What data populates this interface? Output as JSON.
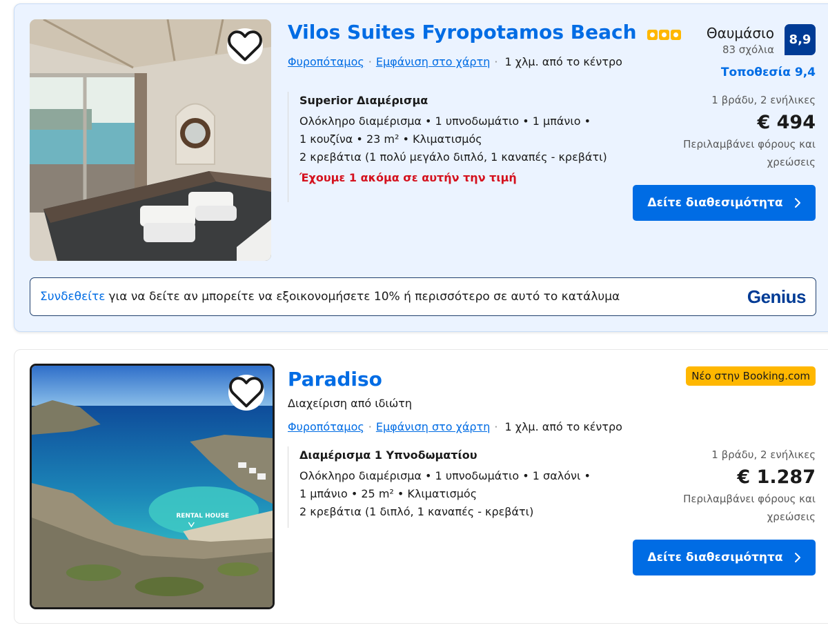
{
  "listings": [
    {
      "title": "Vilos Suites Fyropotamos Beach",
      "star_rating": 3,
      "location_link": "Φυροπόταμος",
      "map_link": "Εμφάνιση στο χάρτη",
      "distance": "1 χλμ. από το κέντρο",
      "rating_word": "Θαυμάσιο",
      "review_count": "83 σχόλια",
      "score": "8,9",
      "location_score": "Τοποθεσία 9,4",
      "room_name": "Superior Διαμέρισμα",
      "room_details": [
        "Ολόκληρο διαμέρισμα • 1 υπνοδωμάτιο • 1 μπάνιο •",
        "1 κουζίνα • 23 m² • Κλιματισμός",
        "2 κρεβάτια (1 πολύ μεγάλο διπλό, 1 καναπές - κρεβάτι)"
      ],
      "availability_warning": "Έχουμε 1 ακόμα σε αυτήν την τιμή",
      "nights_guests": "1 βράδυ, 2 ενήλικες",
      "price": "€ 494",
      "taxes_note": "Περιλαμβάνει φόρους και χρεώσεις",
      "cta": "Δείτε διαθεσιμότητα",
      "genius": {
        "signin_link": "Συνδεθείτε",
        "message": "για να δείτε αν μπορείτε να εξοικονομήσετε 10% ή περισσότερο σε αυτό το κατάλυμα",
        "logo": "Genius"
      }
    },
    {
      "title": "Paradiso",
      "badge": "Νέο στην Booking.com",
      "host_type": "Διαχείριση από ιδιώτη",
      "location_link": "Φυροπόταμος",
      "map_link": "Εμφάνιση στο χάρτη",
      "distance": "1 χλμ. από το κέντρο",
      "room_name": "Διαμέρισμα 1 Υπνοδωματίου",
      "room_details": [
        "Ολόκληρο διαμέρισμα • 1 υπνοδωμάτιο • 1 σαλόνι •",
        "1 μπάνιο • 25 m² • Κλιματισμός",
        "2 κρεβάτια (1 διπλό, 1 καναπές - κρεβάτι)"
      ],
      "photo_watermark": "RENTAL HOUSE",
      "nights_guests": "1 βράδυ, 2 ενήλικες",
      "price": "€ 1.287",
      "taxes_note": "Περιλαμβάνει φόρους και χρεώσεις",
      "cta": "Δείτε διαθεσιμότητα"
    }
  ],
  "icons": {
    "favorite": "heart-outline-icon",
    "cta_arrow": "chevron-right-icon"
  },
  "colors": {
    "link_blue": "#006ce4",
    "score_navy": "#003b95",
    "urgency_red": "#d4111e",
    "badge_yellow": "#ffb700",
    "highlight_bg": "#ebf3ff"
  }
}
